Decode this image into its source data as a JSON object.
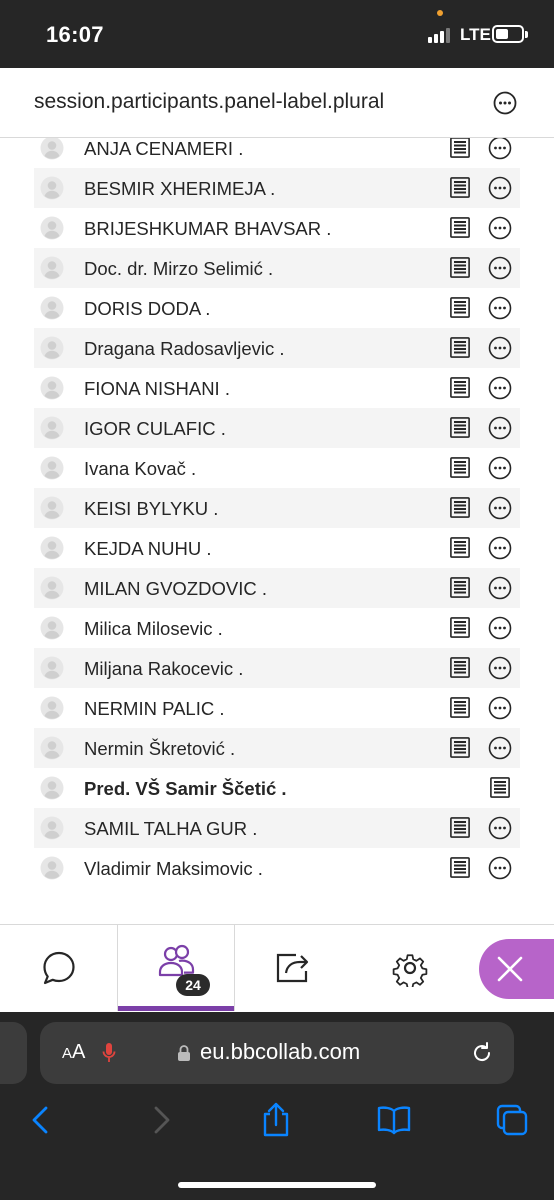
{
  "status_bar": {
    "time": "16:07",
    "network": "LTE"
  },
  "panel": {
    "title": "session.participants.panel-label.plural"
  },
  "participants": [
    {
      "name": "ANJA CENAMERI .",
      "bold": false,
      "more": true
    },
    {
      "name": "BESMIR XHERIMEJA .",
      "bold": false,
      "more": true
    },
    {
      "name": "BRIJESHKUMAR BHAVSAR .",
      "bold": false,
      "more": true
    },
    {
      "name": "Doc. dr. Mirzo Selimić .",
      "bold": false,
      "more": true
    },
    {
      "name": "DORIS DODA .",
      "bold": false,
      "more": true
    },
    {
      "name": "Dragana Radosavljevic .",
      "bold": false,
      "more": true
    },
    {
      "name": "FIONA NISHANI .",
      "bold": false,
      "more": true
    },
    {
      "name": "IGOR CULAFIC .",
      "bold": false,
      "more": true
    },
    {
      "name": "Ivana Kovač .",
      "bold": false,
      "more": true
    },
    {
      "name": "KEISI BYLYKU .",
      "bold": false,
      "more": true
    },
    {
      "name": "KEJDA NUHU .",
      "bold": false,
      "more": true
    },
    {
      "name": "MILAN GVOZDOVIC .",
      "bold": false,
      "more": true
    },
    {
      "name": "Milica Milosevic .",
      "bold": false,
      "more": true
    },
    {
      "name": "Miljana Rakocevic .",
      "bold": false,
      "more": true
    },
    {
      "name": "NERMIN PALIC .",
      "bold": false,
      "more": true
    },
    {
      "name": "Nermin Škretović .",
      "bold": false,
      "more": true
    },
    {
      "name": "Pred. VŠ Samir Ščetić .",
      "bold": true,
      "more": false
    },
    {
      "name": "SAMIL TALHA GUR .",
      "bold": false,
      "more": true
    },
    {
      "name": "Vladimir Maksimovic .",
      "bold": false,
      "more": true
    }
  ],
  "toolbar": {
    "items": [
      "chat-icon",
      "participants-icon",
      "share-icon",
      "settings-icon",
      "close-icon"
    ],
    "participant_count": "24",
    "accent_color": "#7b3fa8",
    "close_color": "#b764c9"
  },
  "browser": {
    "aa_label_big": "A",
    "aa_label_small": "A",
    "url": "eu.bbcollab.com",
    "accent_color": "#0a84ff"
  }
}
